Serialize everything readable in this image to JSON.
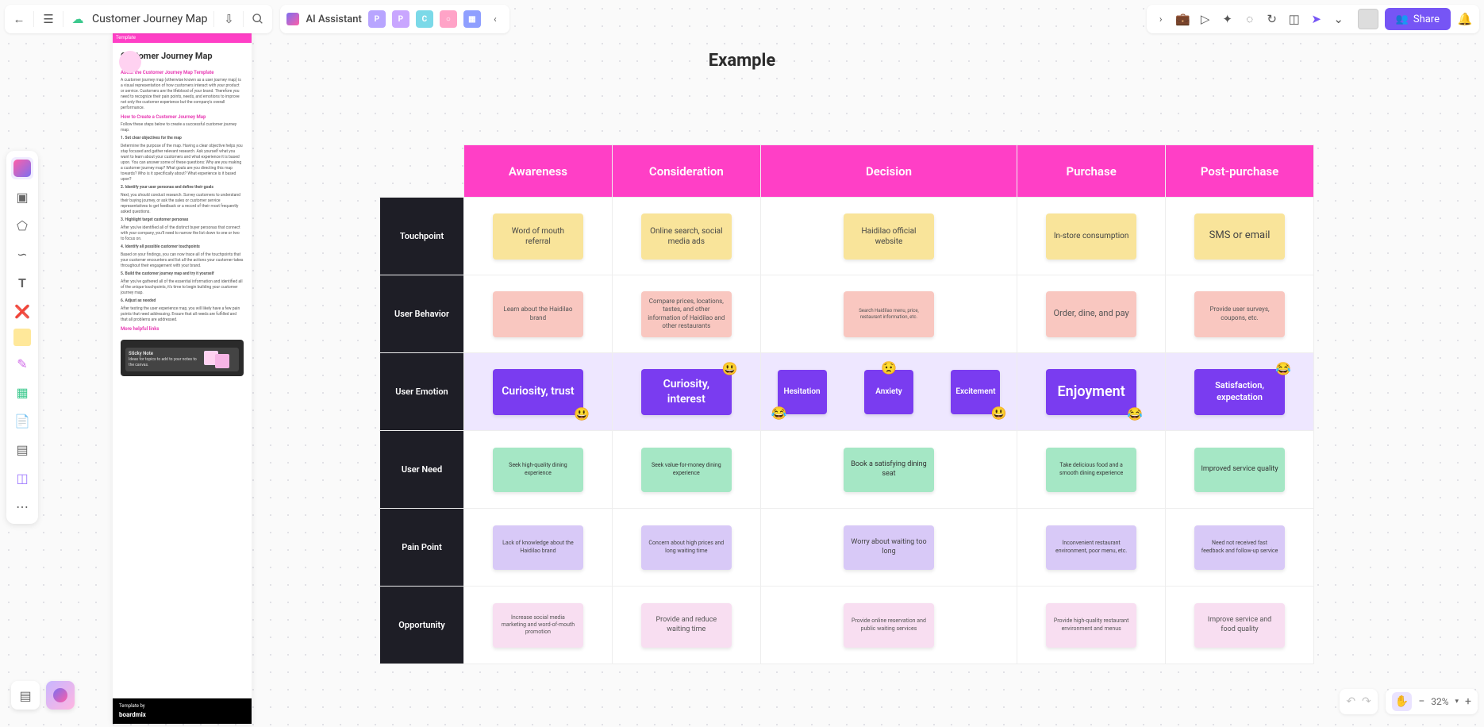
{
  "header": {
    "doc_title": "Customer Journey Map",
    "ai_label": "AI Assistant",
    "share_label": "Share"
  },
  "bottom": {
    "zoom": "32%"
  },
  "canvas": {
    "title": "Example"
  },
  "sidebar": {
    "tab": "Template",
    "title": "Customer Journey Map",
    "h_about": "About the Customer Journey Map Template",
    "p_about": "A customer journey map (otherwise known as a user journey map) is a visual representation of how customers interact with your product or service. Customers are the lifeblood of your brand. Therefore you need to recognize their pain points, needs, and emotions to improve not only the customer experience but the company's overall performance.",
    "h_create": "How to Create a Customer Journey Map",
    "p_create1": "Follow these steps below to create a successful customer journey map.",
    "step1_t": "1. Set clear objectives for the map",
    "step1_p": "Determine the purpose of the map. Having a clear objective helps you stay focused and gather relevant research. Ask yourself what you want to learn about your customers and what experience it is based upon. You can answer some of these questions: Why are you making a customer journey map? What goals are you directing this map towards? Who is it specifically about? What experience is it based upon?",
    "step2_t": "2. Identify your user personas and define their goals",
    "step2_p": "Next, you should conduct research. Survey customers to understand their buying journey, or ask the sales or customer service representatives to get feedback or a record of their most frequently asked questions.",
    "step3_t": "3. Highlight target customer personas",
    "step3_p": "After you've identified all of the distinct buyer personas that connect with your company, you'll need to narrow the list down to one or two to focus on.",
    "step4_t": "4. Identify all possible customer touchpoints",
    "step4_p": "Based on your findings, you can now trace all of the touchpoints that your customer encounters and list all the actions your customer takes throughout their engagement with your brand.",
    "step5_t": "5. Build the customer journey map and try it yourself",
    "step5_p": "After you've gathered all of the essential information and identified all of the unique touchpoints, it's time to begin building your customer journey map.",
    "step6_t": "6. Adjust as needed",
    "step6_p": "After testing the user experience map, you will likely have a few pain points that need addressing. Ensure that all needs are fulfilled and that all problems are addressed.",
    "help_label": "More helpful links",
    "help_card_title": "Sticky Note",
    "help_card_desc": "Ideas for topics to add to your notes to the canvas.",
    "footer_label": "Template by",
    "footer_brand": "boardmix"
  },
  "table": {
    "stages": [
      "Awareness",
      "Consideration",
      "Decision",
      "Purchase",
      "Post-purchase"
    ],
    "rows": [
      "Touchpoint",
      "User  Behavior",
      "User  Emotion",
      "User  Need",
      "Pain  Point",
      "Opportunity"
    ],
    "touchpoint": [
      "Word of mouth referral",
      "Online search, social media ads",
      "Haidilao official website",
      "In-store consumption",
      "SMS  or email"
    ],
    "behavior": [
      "Learn about the Haidilao brand",
      "Compare prices, locations, tastes, and other information of Haidilao and other restaurants",
      "Search Haidilao menu, price, restaurant information, etc.",
      "Order, dine, and pay",
      "Provide user surveys, coupons, etc."
    ],
    "emotion_simple": {
      "awareness": "Curiosity, trust",
      "consideration": "Curiosity, interest",
      "purchase": "Enjoyment",
      "post": "Satisfaction, expectation"
    },
    "emotion_decision": [
      "Hesitation",
      "Anxiety",
      "Excitement"
    ],
    "need": [
      "Seek high-quality dining experience",
      "Seek value-for-money dining experience",
      "Book a satisfying dining seat",
      "Take delicious food and a smooth dining experience",
      "Improved service quality"
    ],
    "pain": [
      "Lack of knowledge about the Haidilao brand",
      "Concern about high prices and long waiting time",
      "Worry about waiting too long",
      "Inconvenient restaurant environment, poor menu, etc.",
      "Need not received fast feedback and follow-up service"
    ],
    "opportunity": [
      "Increase social media marketing and word-of-mouth promotion",
      "Provide and reduce waiting time",
      "Provide online reservation and public waiting services",
      "Provide high-quality restaurant environment and menus",
      "Improve service and food quality"
    ]
  }
}
